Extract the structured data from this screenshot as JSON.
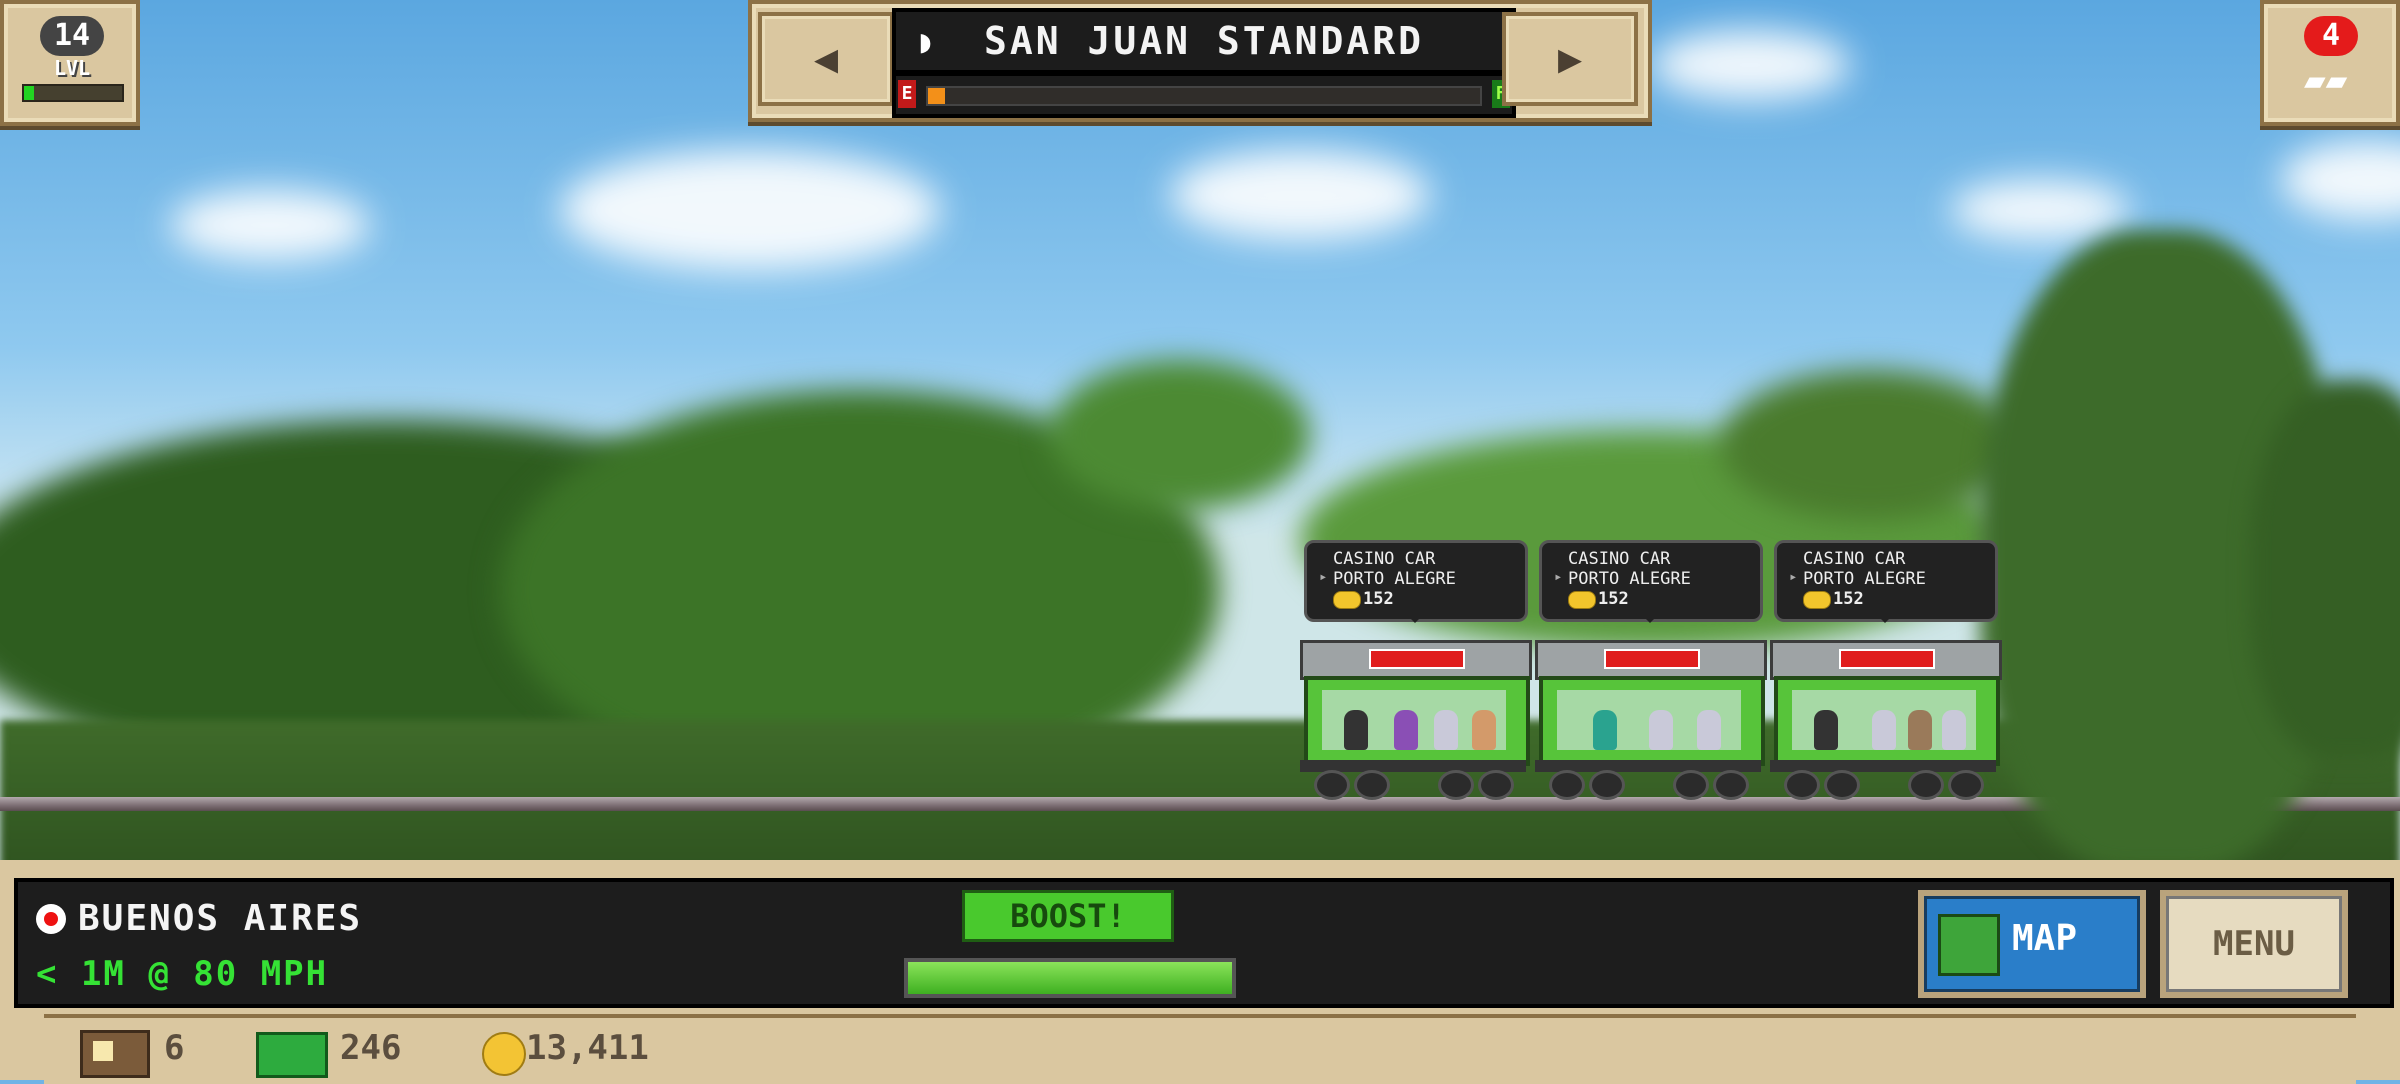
{
  "hud": {
    "level": {
      "number": "14",
      "label": "LVL",
      "progress": 0.1
    },
    "trains": {
      "count": "4"
    },
    "route": {
      "name": "SAN JUAN STANDARD",
      "start": "E",
      "end": "F",
      "progress": 0.03
    },
    "station": {
      "name": "BUENOS AIRES"
    },
    "travel": {
      "status": "< 1M @ 80 MPH"
    },
    "boost": {
      "label": "BOOST!",
      "progress": 1.0
    },
    "buttons": {
      "map": "MAP",
      "menu": "MENU"
    },
    "resources": {
      "crates": "6",
      "cash": "246",
      "coins": "13,411"
    }
  },
  "cars": [
    {
      "type": "CASINO CAR",
      "destination": "PORTO ALEGRE",
      "coins": "152"
    },
    {
      "type": "CASINO CAR",
      "destination": "PORTO ALEGRE",
      "coins": "152"
    },
    {
      "type": "CASINO CAR",
      "destination": "PORTO ALEGRE",
      "coins": "152"
    }
  ],
  "colors": {
    "accent": "#49c92d",
    "panel": "#dac7a0",
    "boost": "#49c92d",
    "map": "#2a7ec9"
  },
  "icons": [
    "level-badge-icon",
    "train-icon",
    "route-icon",
    "station-icon",
    "crate-icon",
    "cash-icon",
    "coin-icon",
    "map-icon"
  ]
}
